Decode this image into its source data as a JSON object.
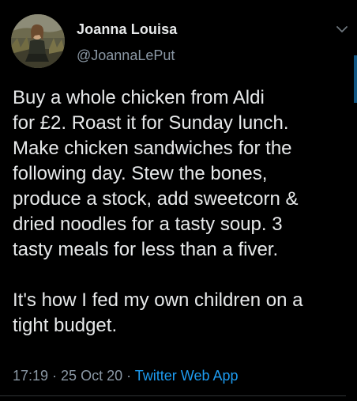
{
  "author": {
    "display_name": "Joanna Louisa",
    "handle": "@JoannaLePut"
  },
  "tweet": {
    "text": "Buy a whole chicken from Aldi\nfor £2. Roast it for Sunday lunch.\nMake chicken sandwiches for the\nfollowing day. Stew the bones,\nproduce a stock, add sweetcorn &\ndried noodles for a tasty soup. 3\ntasty meals for less than a fiver.\n\nIt's how I fed my own children on a\ntight budget."
  },
  "meta": {
    "time": "17:19",
    "separator_1": " · ",
    "date": "25 Oct 20",
    "separator_2": " · ",
    "source": "Twitter Web App"
  },
  "icons": {
    "more": "chevron-down-icon",
    "avatar": "profile-photo"
  },
  "colors": {
    "background": "#000000",
    "primary_text": "#e7e9ea",
    "secondary_text": "#8b98a5",
    "link": "#1d9bf0",
    "divider": "#2f3336"
  }
}
